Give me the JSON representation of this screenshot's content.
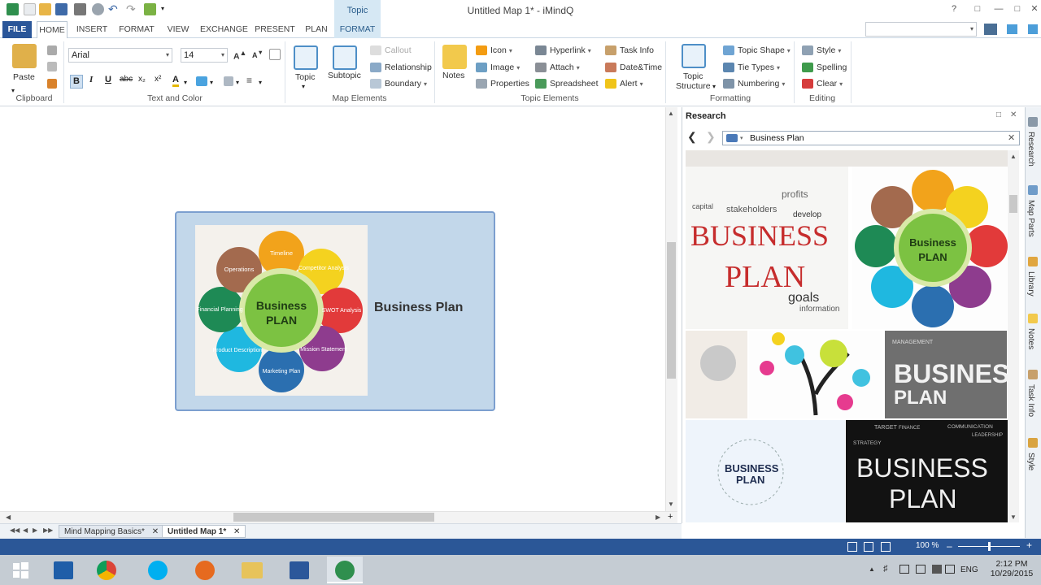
{
  "window": {
    "title": "Untitled Map 1* - iMindQ",
    "context_tab_group": "Topic"
  },
  "tabs": [
    "FILE",
    "HOME",
    "INSERT",
    "FORMAT",
    "VIEW",
    "EXCHANGE",
    "PRESENT",
    "PLAN",
    "FORMAT"
  ],
  "ribbon": {
    "clipboard": {
      "paste": "Paste",
      "label": "Clipboard"
    },
    "text_color": {
      "font": "Arial",
      "size": "14",
      "label": "Text and Color",
      "bold": "B",
      "italic": "I",
      "underline": "U",
      "strike": "abc",
      "sub": "x₂",
      "sup": "x²",
      "font_color": "A"
    },
    "map_elements": {
      "topic": "Topic",
      "subtopic": "Subtopic",
      "callout": "Callout",
      "relationship": "Relationship",
      "boundary": "Boundary",
      "label": "Map Elements"
    },
    "topic_elements": {
      "notes": "Notes",
      "icon": "Icon",
      "image": "Image",
      "properties": "Properties",
      "hyperlink": "Hyperlink",
      "attach": "Attach",
      "spreadsheet": "Spreadsheet",
      "task_info": "Task Info",
      "date_time": "Date&Time",
      "alert": "Alert",
      "label": "Topic Elements"
    },
    "formatting": {
      "topic_structure_1": "Topic",
      "topic_structure_2": "Structure",
      "topic_shape": "Topic Shape",
      "tie_types": "Tie Types",
      "numbering": "Numbering",
      "label": "Formatting"
    },
    "editing": {
      "style": "Style",
      "spelling": "Spelling",
      "clear": "Clear",
      "label": "Editing"
    }
  },
  "canvas": {
    "topic_text": "Business Plan",
    "image_center_1": "Business",
    "image_center_2": "PLAN",
    "petals": [
      "Timeline",
      "Competitor Analysis",
      "SWOT Analysis",
      "Mission Statement",
      "Marketing Plan",
      "Product Description",
      "Financial Planning",
      "Operations"
    ]
  },
  "sheets": [
    "Mind Mapping Basics*",
    "Untitled Map 1*"
  ],
  "research": {
    "title": "Research",
    "query": "Business Plan",
    "result_texts": [
      "BUSINESS",
      "PLAN",
      "goals",
      "information",
      "stakeholders",
      "capital",
      "profits",
      "develop",
      "BUSINESS",
      "PLAN",
      "BUSINESS",
      "PLAN",
      "MANAGEMENT",
      "STRATEGY",
      "COMMUNICATION",
      "TARGET",
      "FINANCE",
      "LEADERSHIP"
    ]
  },
  "side_tabs": [
    "Research",
    "Map Parts",
    "Library",
    "Notes",
    "Task Info",
    "Style"
  ],
  "status": {
    "zoom": "100 %"
  },
  "taskbar": {
    "time": "2:12 PM",
    "date": "10/29/2015",
    "lang": "ENG"
  }
}
